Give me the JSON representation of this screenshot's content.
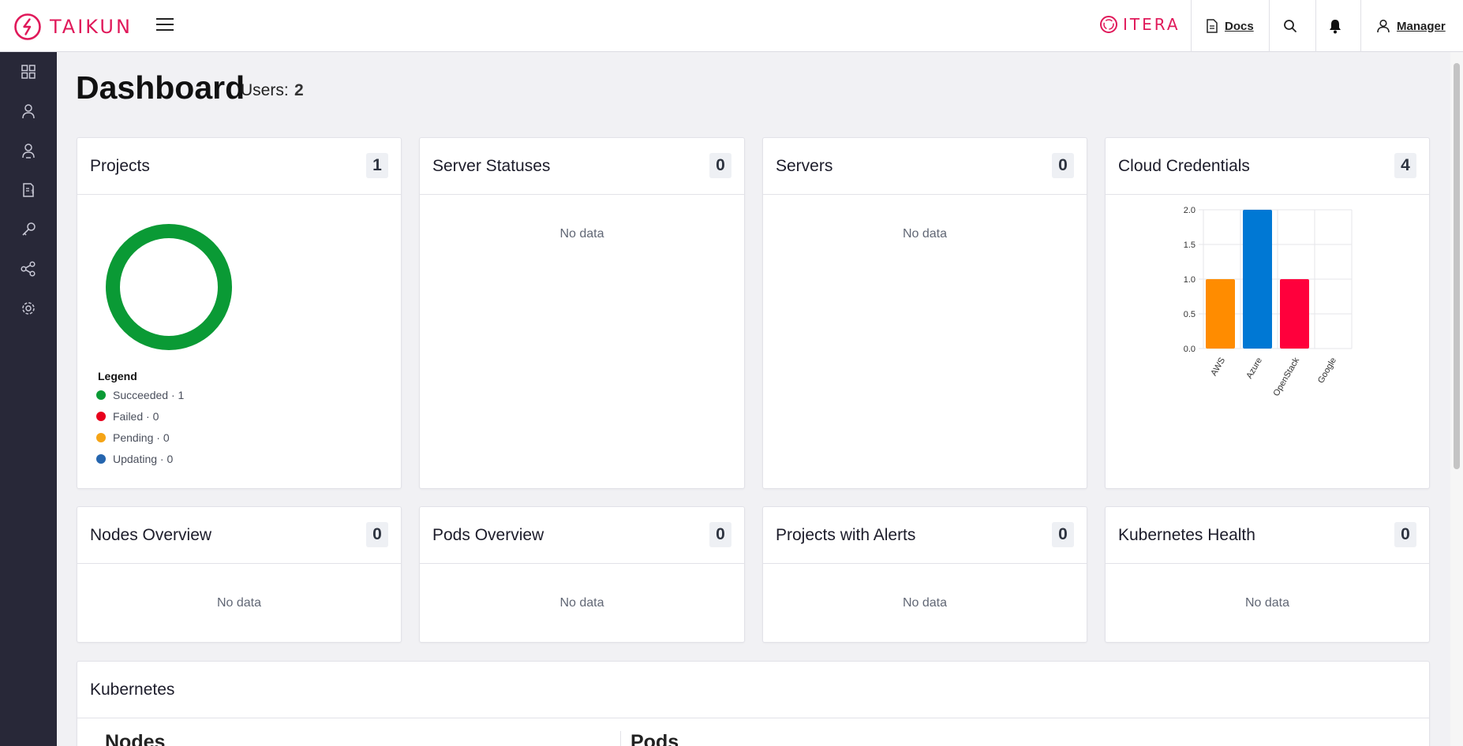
{
  "brand": {
    "name": "TAIKUN",
    "partner": "ITERA",
    "accent": "#e0195a"
  },
  "topbar": {
    "docs_label": "Docs",
    "user_label": "Manager"
  },
  "sidebar": {
    "items": [
      "dashboard-icon",
      "user-icon",
      "users-icon",
      "billing-icon",
      "key-icon",
      "share-icon",
      "settings-icon"
    ]
  },
  "page": {
    "title": "Dashboard",
    "users_label": "Users:",
    "users_count": "2"
  },
  "cards": {
    "projects": {
      "title": "Projects",
      "count": "1"
    },
    "server_statuses": {
      "title": "Server Statuses",
      "count": "0",
      "empty": "No data"
    },
    "servers": {
      "title": "Servers",
      "count": "0",
      "empty": "No data"
    },
    "cloud_credentials": {
      "title": "Cloud Credentials",
      "count": "4"
    },
    "nodes_overview": {
      "title": "Nodes Overview",
      "count": "0",
      "empty": "No data"
    },
    "pods_overview": {
      "title": "Pods Overview",
      "count": "0",
      "empty": "No data"
    },
    "projects_alerts": {
      "title": "Projects with Alerts",
      "count": "0",
      "empty": "No data"
    },
    "kubernetes_health": {
      "title": "Kubernetes Health",
      "count": "0",
      "empty": "No data"
    },
    "kubernetes": {
      "title": "Kubernetes",
      "nodes_label": "Nodes",
      "pods_label": "Pods"
    }
  },
  "legend": {
    "title": "Legend",
    "items": [
      {
        "label": "Succeeded · 1",
        "color": "#0a9a35"
      },
      {
        "label": "Failed · 0",
        "color": "#e8001c"
      },
      {
        "label": "Pending · 0",
        "color": "#f5a416"
      },
      {
        "label": "Updating · 0",
        "color": "#2565ae"
      }
    ]
  },
  "chart_data": [
    {
      "type": "pie",
      "categories": [
        "Succeeded",
        "Failed",
        "Pending",
        "Updating"
      ],
      "values": [
        1,
        0,
        0,
        0
      ],
      "colors": [
        "#0a9a35",
        "#e8001c",
        "#f5a416",
        "#2565ae"
      ],
      "legend": "bottom",
      "title": "",
      "xlabel": "",
      "ylabel": ""
    },
    {
      "type": "bar",
      "categories": [
        "AWS",
        "Azure",
        "OpenStack",
        "Google"
      ],
      "values": [
        1,
        2,
        1,
        0
      ],
      "colors": [
        "#ff8c00",
        "#0078d4",
        "#ff003c",
        "#34a853"
      ],
      "yticks": [
        "0.0",
        "0.5",
        "1.0",
        "1.5",
        "2.0"
      ],
      "ylim": [
        0,
        2
      ],
      "grid": true,
      "title": "",
      "xlabel": "",
      "ylabel": ""
    }
  ]
}
